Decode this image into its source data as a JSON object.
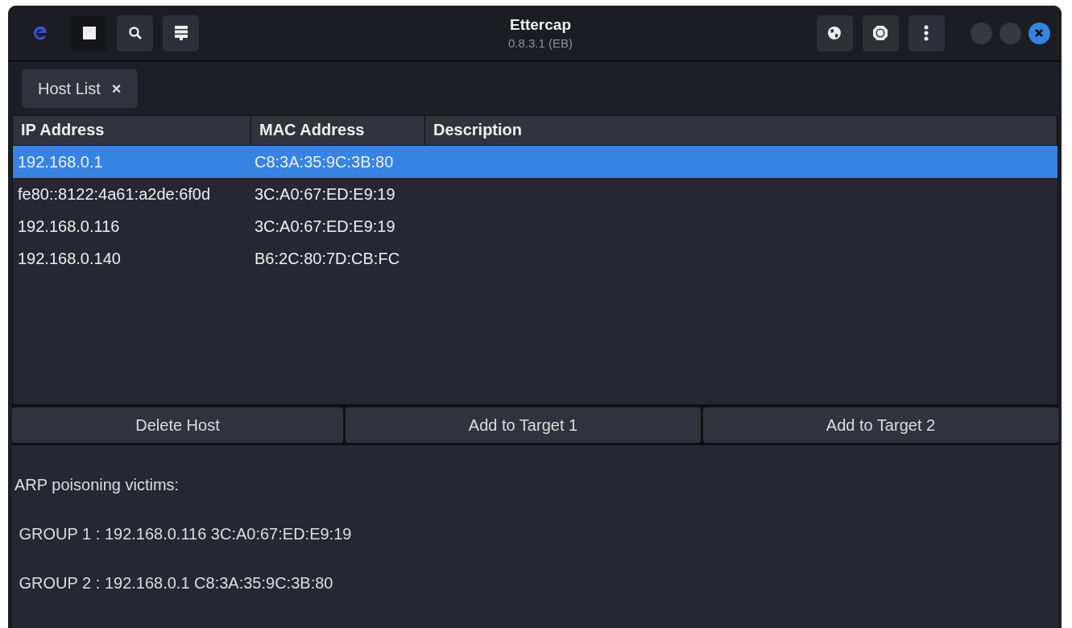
{
  "window": {
    "title": "Ettercap",
    "subtitle": "0.8.3.1 (EB)"
  },
  "tabs": [
    {
      "label": "Host List",
      "close": "×",
      "selected": true
    }
  ],
  "table": {
    "columns": [
      "IP Address",
      "MAC Address",
      "Description"
    ],
    "rows": [
      {
        "ip": "192.168.0.1",
        "mac": "C8:3A:35:9C:3B:80",
        "selected": true
      },
      {
        "ip": "fe80::8122:4a61:a2de:6f0d",
        "mac": "3C:A0:67:ED:E9:19",
        "selected": false
      },
      {
        "ip": "192.168.0.116",
        "mac": "3C:A0:67:ED:E9:19",
        "selected": false
      },
      {
        "ip": "192.168.0.140",
        "mac": "B6:2C:80:7D:CB:FC",
        "selected": false
      }
    ]
  },
  "buttons": [
    "Delete Host",
    "Add to Target 1",
    "Add to Target 2"
  ],
  "log": [
    "ARP poisoning victims:",
    " GROUP 1 : 192.168.0.116 3C:A0:67:ED:E9:19",
    " GROUP 2 : 192.168.0.1 C8:3A:35:9C:3B:80"
  ]
}
